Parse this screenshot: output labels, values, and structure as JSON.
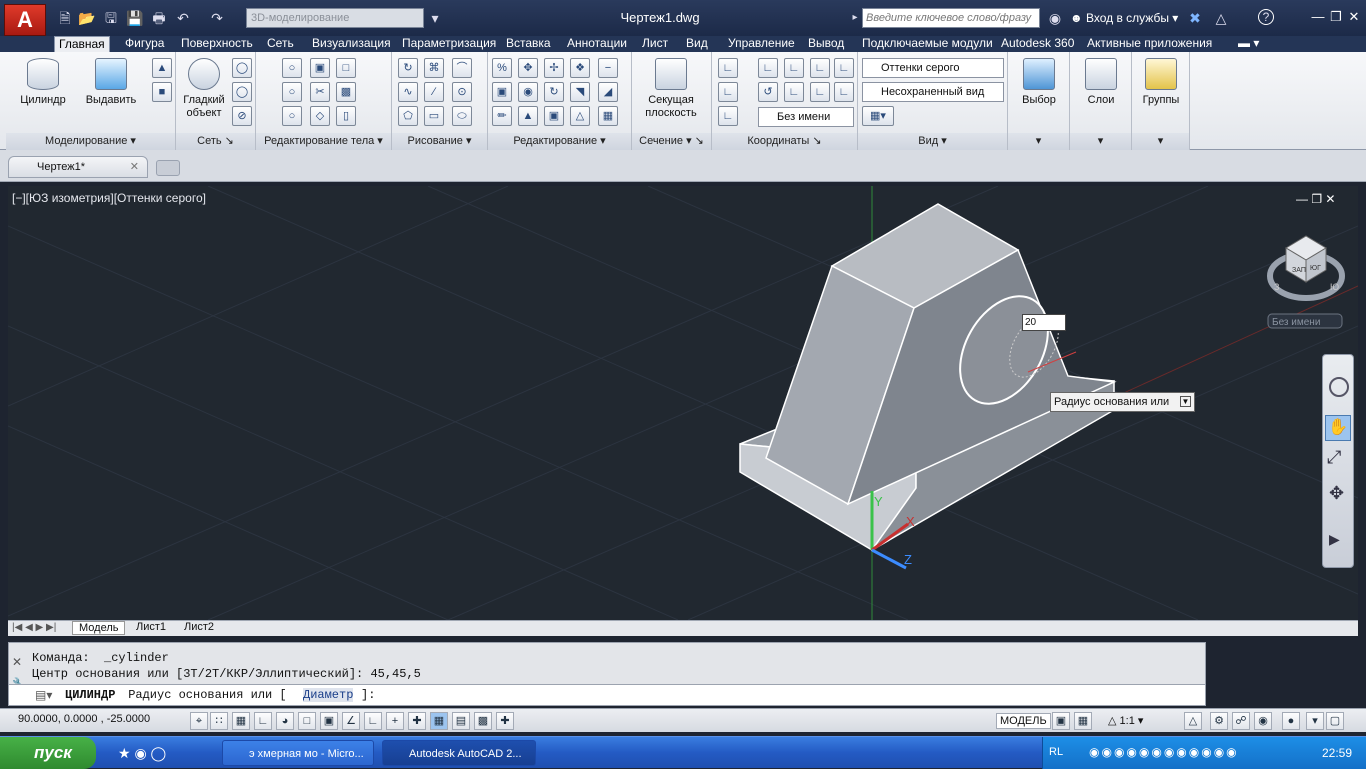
{
  "titlebar": {
    "logo": "A",
    "workspace": "3D-моделирование",
    "document_title": "Чертеж1.dwg",
    "search_placeholder": "Введите ключевое слово/фразу",
    "sign_in": "Вход в службы",
    "help_label": "?"
  },
  "ribbon_tabs": [
    "Главная",
    "Фигура",
    "Поверхность",
    "Сеть",
    "Визуализация",
    "Параметризация",
    "Вставка",
    "Аннотации",
    "Лист",
    "Вид",
    "Управление",
    "Вывод",
    "Подключаемые модули",
    "Autodesk 360",
    "Активные приложения"
  ],
  "ribbon": {
    "cylinder": "Цилиндр",
    "extrude": "Выдавить",
    "smooth_object_1": "Гладкий",
    "smooth_object_2": "объект",
    "section_plane_1": "Секущая",
    "section_plane_2": "плоскость",
    "visual_style": "Оттенки серого",
    "named_view": "Несохраненный вид",
    "ucs_name": "Без имени",
    "select": "Выбор",
    "layers": "Слои",
    "groups": "Группы",
    "panels": {
      "modeling": "Моделирование",
      "mesh": "Сеть",
      "solid_editing": "Редактирование тела",
      "draw": "Рисование",
      "modify": "Редактирование",
      "section": "Сечение",
      "coordinates": "Координаты",
      "view": "Вид"
    }
  },
  "file_tab": "Чертеж1*",
  "viewport": {
    "label": "[−][ЮЗ изометрия][Оттенки серого]",
    "dynamic_input": "20",
    "tooltip": "Радиус основания или",
    "viewcube_name": "Без имени",
    "cube_labels": [
      "ЗАП",
      "ЮГ",
      "З",
      "Ю"
    ],
    "axis_labels": [
      "Y",
      "X",
      "Z"
    ]
  },
  "layout_tabs": [
    "Модель",
    "Лист1",
    "Лист2"
  ],
  "command": {
    "history": [
      "Команда:  _cylinder",
      "Центр основания или [3Т/2Т/ККР/Эллиптический]: 45,45,5"
    ],
    "prompt_cmd": "ЦИЛИНДР",
    "prompt_text": " Радиус основания или [",
    "prompt_option": "Диаметр",
    "prompt_end": "]:"
  },
  "status": {
    "coordinates": "90.0000,  0.0000  , -25.0000",
    "model": "МОДЕЛЬ",
    "scale": "1:1"
  },
  "taskbar": {
    "start": "пуск",
    "tasks": [
      "э хмерная мо - Micro...",
      "Autodesk AutoCAD 2..."
    ],
    "lang": "RL",
    "clock": "22:59"
  }
}
